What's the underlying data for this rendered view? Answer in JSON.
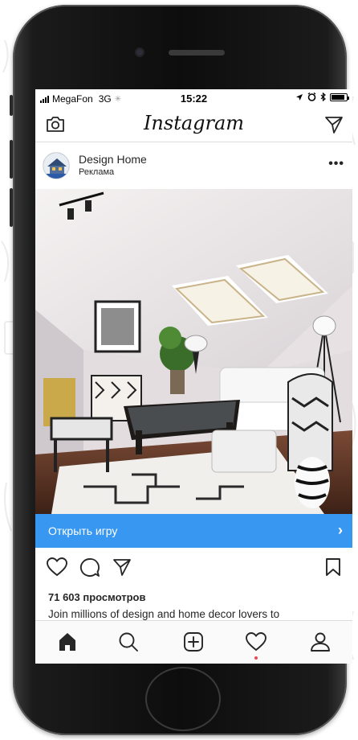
{
  "status_bar": {
    "carrier": "MegaFon",
    "network": "3G",
    "time": "15:22"
  },
  "app": {
    "title": "Instagram"
  },
  "post": {
    "account_name": "Design Home",
    "account_subtitle": "Реклама",
    "cta_label": "Открыть игру",
    "views": "71 603 просмотров",
    "caption": "Join millions of design and home decor lovers to"
  },
  "icons": {
    "header_left": "camera-icon",
    "header_right": "direct-send-icon",
    "more": "more-options-icon",
    "actions": [
      "heart-icon",
      "comment-icon",
      "share-icon",
      "bookmark-icon"
    ],
    "tabs": [
      "home-icon",
      "search-icon",
      "add-post-icon",
      "activity-heart-icon",
      "profile-icon"
    ]
  },
  "colors": {
    "cta_blue": "#3897f0",
    "notification_dot": "#ed4956",
    "text": "#262626"
  }
}
